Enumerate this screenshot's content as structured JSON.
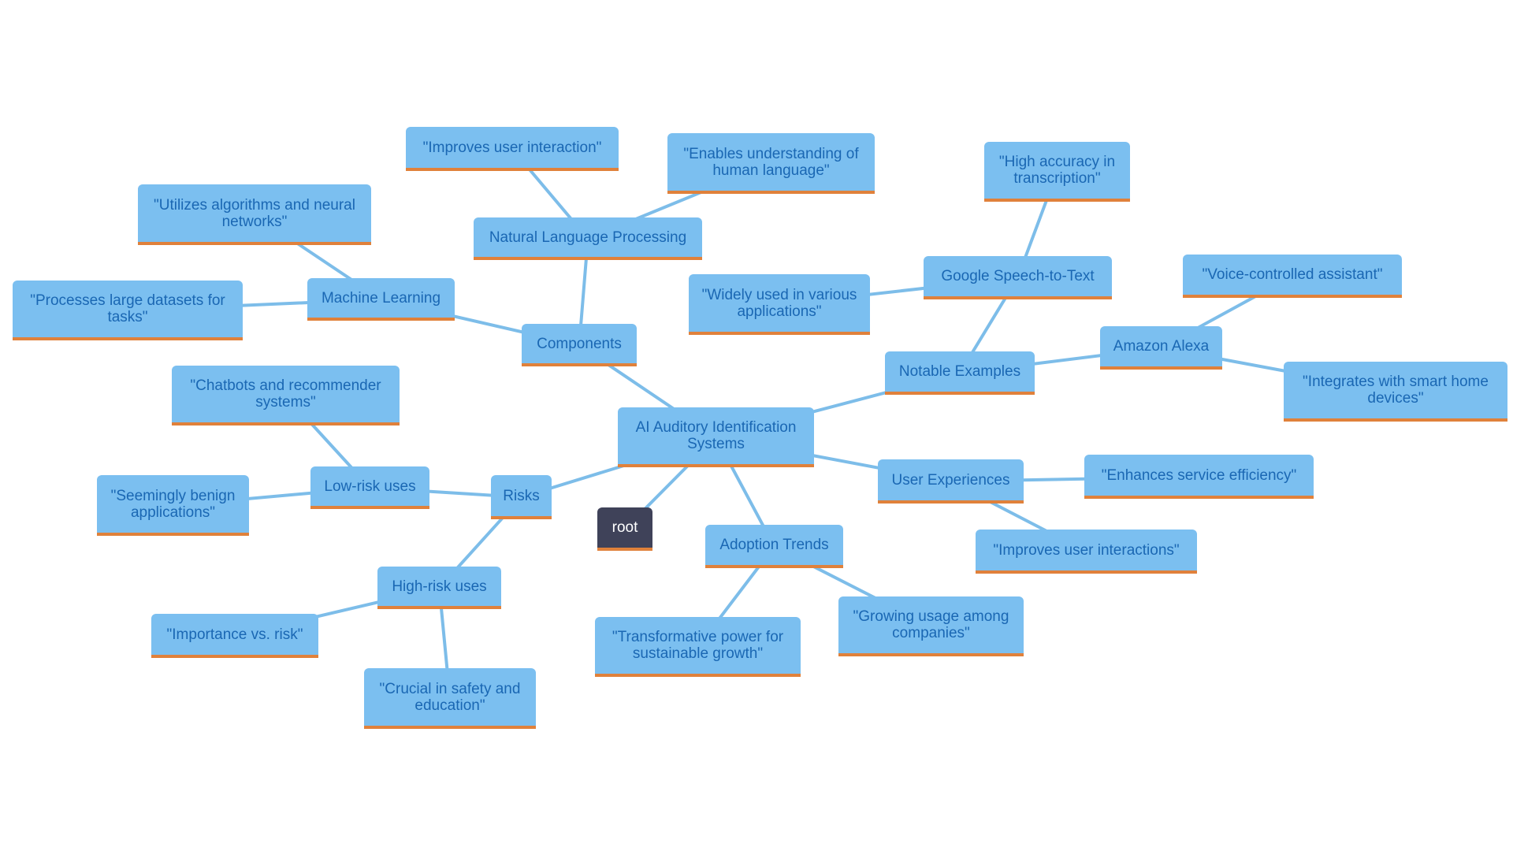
{
  "diagram": {
    "type": "mindmap",
    "colors": {
      "node_fill": "#7bbff0",
      "node_text": "#1a67b3",
      "node_underline": "#e0813b",
      "edge": "#7dbde9",
      "root_fill": "#3f4259",
      "root_text": "#ffffff"
    },
    "nodes": [
      {
        "id": "center",
        "label": "AI Auditory Identification Systems"
      },
      {
        "id": "root",
        "label": "root"
      },
      {
        "id": "components",
        "label": "Components"
      },
      {
        "id": "nlp",
        "label": "Natural Language Processing"
      },
      {
        "id": "nlp1",
        "label": "\"Improves user interaction\""
      },
      {
        "id": "nlp2",
        "label": "\"Enables understanding of human language\""
      },
      {
        "id": "ml",
        "label": "Machine Learning"
      },
      {
        "id": "ml1",
        "label": "\"Utilizes algorithms and neural networks\""
      },
      {
        "id": "ml2",
        "label": "\"Processes large datasets for tasks\""
      },
      {
        "id": "risks",
        "label": "Risks"
      },
      {
        "id": "low",
        "label": "Low-risk uses"
      },
      {
        "id": "low1",
        "label": "\"Chatbots and recommender systems\""
      },
      {
        "id": "low2",
        "label": "\"Seemingly benign applications\""
      },
      {
        "id": "high",
        "label": "High-risk uses"
      },
      {
        "id": "high1",
        "label": "\"Importance vs. risk\""
      },
      {
        "id": "high2",
        "label": "\"Crucial in safety and education\""
      },
      {
        "id": "adoption",
        "label": "Adoption Trends"
      },
      {
        "id": "adopt1",
        "label": "\"Transformative power for sustainable growth\""
      },
      {
        "id": "adopt2",
        "label": "\"Growing usage among companies\""
      },
      {
        "id": "notable",
        "label": "Notable Examples"
      },
      {
        "id": "google",
        "label": "Google Speech-to-Text"
      },
      {
        "id": "google1",
        "label": "\"High accuracy in transcription\""
      },
      {
        "id": "google2",
        "label": "\"Widely used in various applications\""
      },
      {
        "id": "alexa",
        "label": "Amazon Alexa"
      },
      {
        "id": "alexa1",
        "label": "\"Voice-controlled assistant\""
      },
      {
        "id": "alexa2",
        "label": "\"Integrates with smart home devices\""
      },
      {
        "id": "ux",
        "label": "User Experiences"
      },
      {
        "id": "ux1",
        "label": "\"Enhances service efficiency\""
      },
      {
        "id": "ux2",
        "label": "\"Improves user interactions\""
      }
    ],
    "edges": [
      [
        "center",
        "root"
      ],
      [
        "center",
        "components"
      ],
      [
        "components",
        "nlp"
      ],
      [
        "nlp",
        "nlp1"
      ],
      [
        "nlp",
        "nlp2"
      ],
      [
        "components",
        "ml"
      ],
      [
        "ml",
        "ml1"
      ],
      [
        "ml",
        "ml2"
      ],
      [
        "center",
        "risks"
      ],
      [
        "risks",
        "low"
      ],
      [
        "low",
        "low1"
      ],
      [
        "low",
        "low2"
      ],
      [
        "risks",
        "high"
      ],
      [
        "high",
        "high1"
      ],
      [
        "high",
        "high2"
      ],
      [
        "center",
        "adoption"
      ],
      [
        "adoption",
        "adopt1"
      ],
      [
        "adoption",
        "adopt2"
      ],
      [
        "center",
        "notable"
      ],
      [
        "notable",
        "google"
      ],
      [
        "google",
        "google1"
      ],
      [
        "google",
        "google2"
      ],
      [
        "notable",
        "alexa"
      ],
      [
        "alexa",
        "alexa1"
      ],
      [
        "alexa",
        "alexa2"
      ],
      [
        "center",
        "ux"
      ],
      [
        "ux",
        "ux1"
      ],
      [
        "ux",
        "ux2"
      ]
    ]
  }
}
